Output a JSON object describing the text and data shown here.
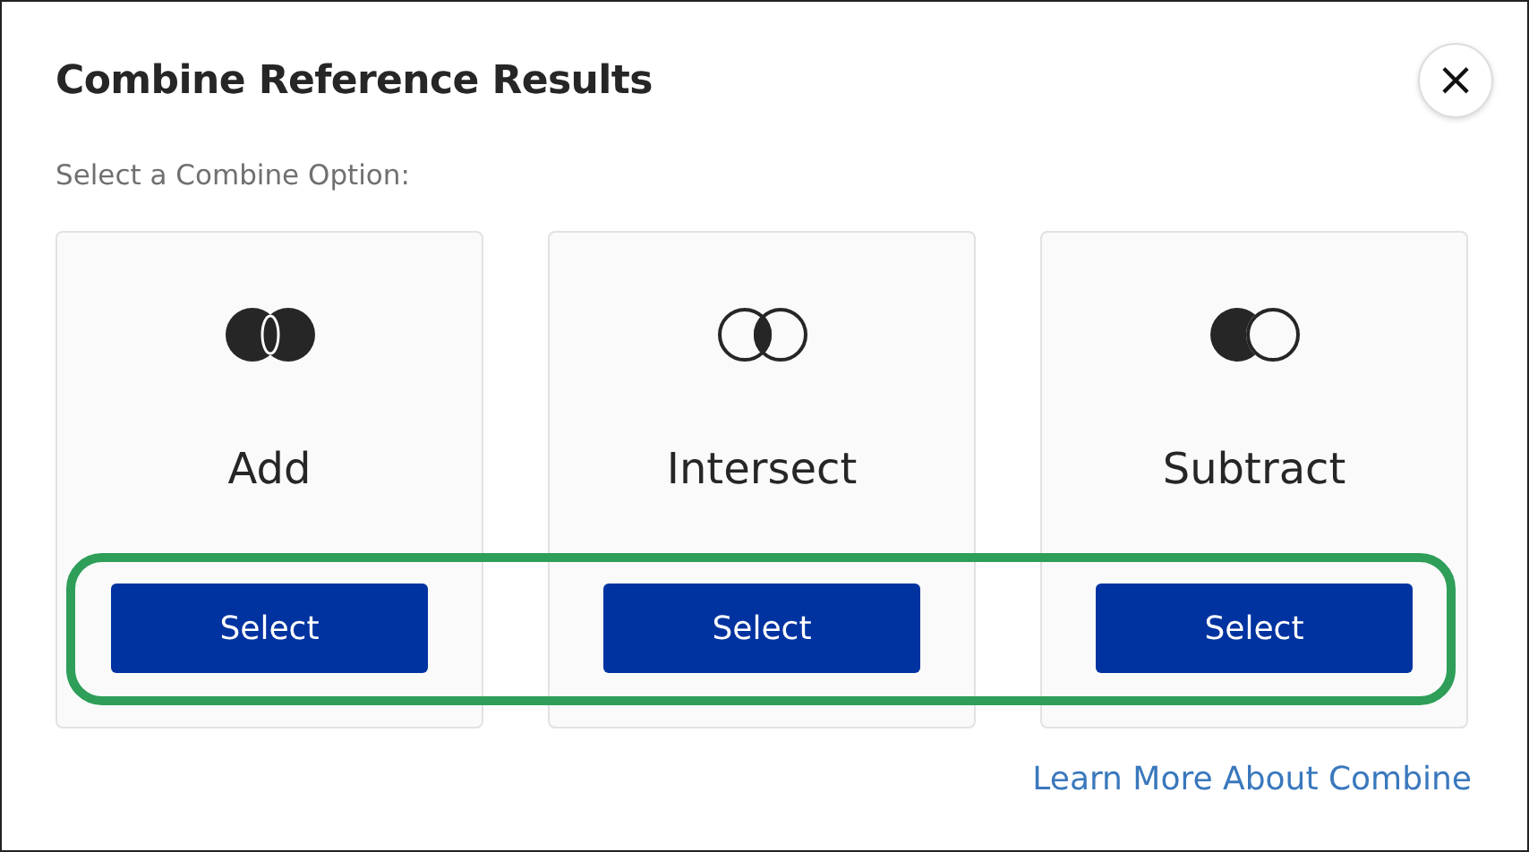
{
  "dialog": {
    "title": "Combine Reference Results",
    "close": "×",
    "prompt": "Select a Combine Option:"
  },
  "options": [
    {
      "kind": "add",
      "label": "Add",
      "button": "Select"
    },
    {
      "kind": "intersect",
      "label": "Intersect",
      "button": "Select"
    },
    {
      "kind": "subtract",
      "label": "Subtract",
      "button": "Select"
    }
  ],
  "link": "Learn More About Combine"
}
